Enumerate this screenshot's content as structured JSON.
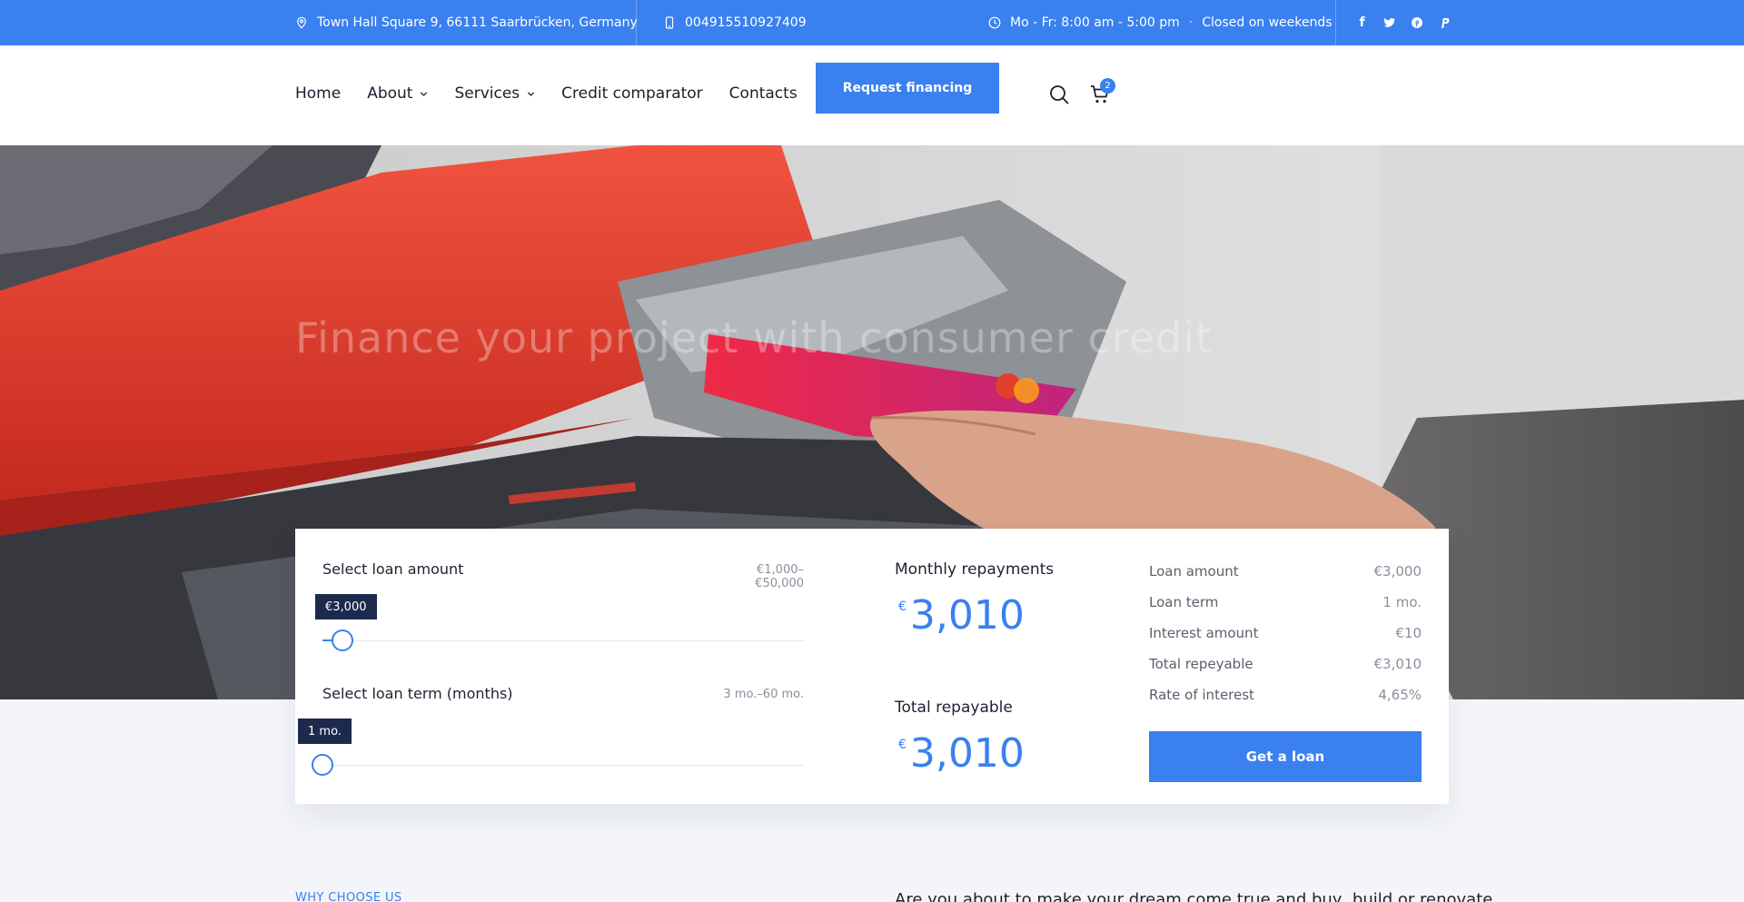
{
  "topbar": {
    "address": "Town Hall Square 9, 66111 Saarbrücken, Germany",
    "phone": "004915510927409",
    "hours": "Mo - Fr: 8:00 am - 5:00 pm",
    "hours_sep": "·",
    "closed": "Closed on weekends",
    "social": [
      "facebook-icon",
      "twitter-icon",
      "pinterest-icon",
      "paypal-icon"
    ],
    "facebook_glyph": "f"
  },
  "nav": {
    "items": [
      {
        "label": "Home",
        "has_dropdown": false
      },
      {
        "label": "About",
        "has_dropdown": true
      },
      {
        "label": "Services",
        "has_dropdown": true
      },
      {
        "label": "Credit comparator",
        "has_dropdown": false
      },
      {
        "label": "Contacts",
        "has_dropdown": false
      }
    ],
    "cta": "Request financing",
    "cart_count": "2",
    "icons": [
      "search-icon",
      "cart-icon"
    ]
  },
  "hero": {
    "title": "Finance your project with consumer credit"
  },
  "calculator": {
    "amount": {
      "title": "Select loan amount",
      "range": "€1,000–€50,000",
      "tooltip": "€3,000",
      "value": 3000,
      "min": 1000,
      "max": 50000
    },
    "term": {
      "title": "Select loan term (months)",
      "range": "3 mo.–60 mo.",
      "tooltip": "1 mo.",
      "value": 1,
      "min": 1,
      "max": 60
    },
    "monthly": {
      "label": "Monthly repayments",
      "currency": "€",
      "value": "3,010"
    },
    "total": {
      "label": "Total repayable",
      "currency": "€",
      "value": "3,010"
    },
    "summary": [
      {
        "label": "Loan amount",
        "value": "€3,000"
      },
      {
        "label": "Loan term",
        "value": "1 mo."
      },
      {
        "label": "Interest amount",
        "value": "€10"
      },
      {
        "label": "Total repeyable",
        "value": "€3,010"
      },
      {
        "label": "Rate of interest",
        "value": "4,65%"
      }
    ],
    "button": "Get a loan"
  },
  "section": {
    "eyebrow": "WHY CHOOSE US",
    "intro": "Are you about to make your dream come true and buy, build or renovate"
  },
  "colors": {
    "accent": "#3a80ef",
    "tooltip_bg": "#1d2a4d",
    "page_bg": "#f3f5f9"
  }
}
